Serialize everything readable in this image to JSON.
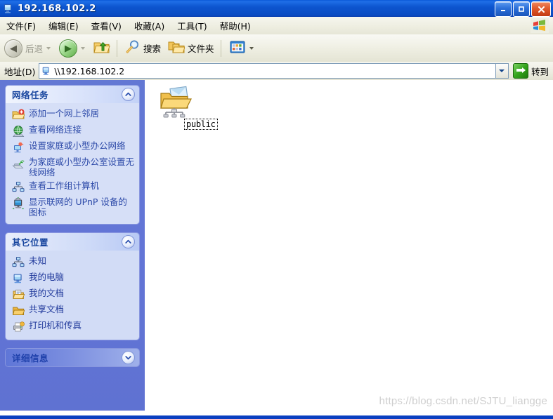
{
  "window": {
    "title": "192.168.102.2",
    "title_icon": "computer-icon",
    "minimize_glyph": "–",
    "maximize_glyph": "□",
    "close_glyph": "✕"
  },
  "menubar": {
    "items": [
      {
        "label": "文件(F)"
      },
      {
        "label": "编辑(E)"
      },
      {
        "label": "查看(V)"
      },
      {
        "label": "收藏(A)"
      },
      {
        "label": "工具(T)"
      },
      {
        "label": "帮助(H)"
      }
    ],
    "logo": "windows-flag-icon"
  },
  "toolbar": {
    "back_label": "后退",
    "forward_label": "",
    "up_label": "",
    "search_label": "搜索",
    "folders_label": "文件夹",
    "views_label": ""
  },
  "address": {
    "label": "地址(D)",
    "value": "\\\\192.168.102.2",
    "placeholder": "",
    "go_label": "转到"
  },
  "sidebar": {
    "panels": [
      {
        "title": "网络任务",
        "state": "expanded",
        "items": [
          {
            "label": "添加一个网上邻居",
            "icon": "add-network-place-icon"
          },
          {
            "label": "查看网络连接",
            "icon": "network-connections-icon"
          },
          {
            "label": "设置家庭或小型办公网络",
            "icon": "setup-network-icon"
          },
          {
            "label": "为家庭或小型办公室设置无线网络",
            "icon": "wireless-network-icon"
          },
          {
            "label": "查看工作组计算机",
            "icon": "workgroup-computers-icon"
          },
          {
            "label": "显示联网的 UPnP 设备的图标",
            "icon": "upnp-devices-icon"
          }
        ]
      },
      {
        "title": "其它位置",
        "state": "expanded",
        "items": [
          {
            "label": "未知",
            "icon": "network-icon"
          },
          {
            "label": "我的电脑",
            "icon": "my-computer-icon"
          },
          {
            "label": "我的文档",
            "icon": "my-documents-icon"
          },
          {
            "label": "共享文档",
            "icon": "shared-documents-icon"
          },
          {
            "label": "打印机和传真",
            "icon": "printers-faxes-icon"
          }
        ]
      },
      {
        "title": "详细信息",
        "state": "collapsed",
        "items": []
      }
    ]
  },
  "files": {
    "items": [
      {
        "name": "public",
        "icon": "shared-network-folder-icon",
        "selected": true
      }
    ]
  },
  "watermark": {
    "text": "https://blog.csdn.net/SJTU_liangge"
  },
  "colors": {
    "titlebar_blue": "#0a56d6",
    "sidebar_blue": "#6375d6",
    "panel_body": "#d6dff7",
    "link_blue": "#2c49a8",
    "heading_blue": "#17459e",
    "status_blue": "#0a3fc0"
  }
}
